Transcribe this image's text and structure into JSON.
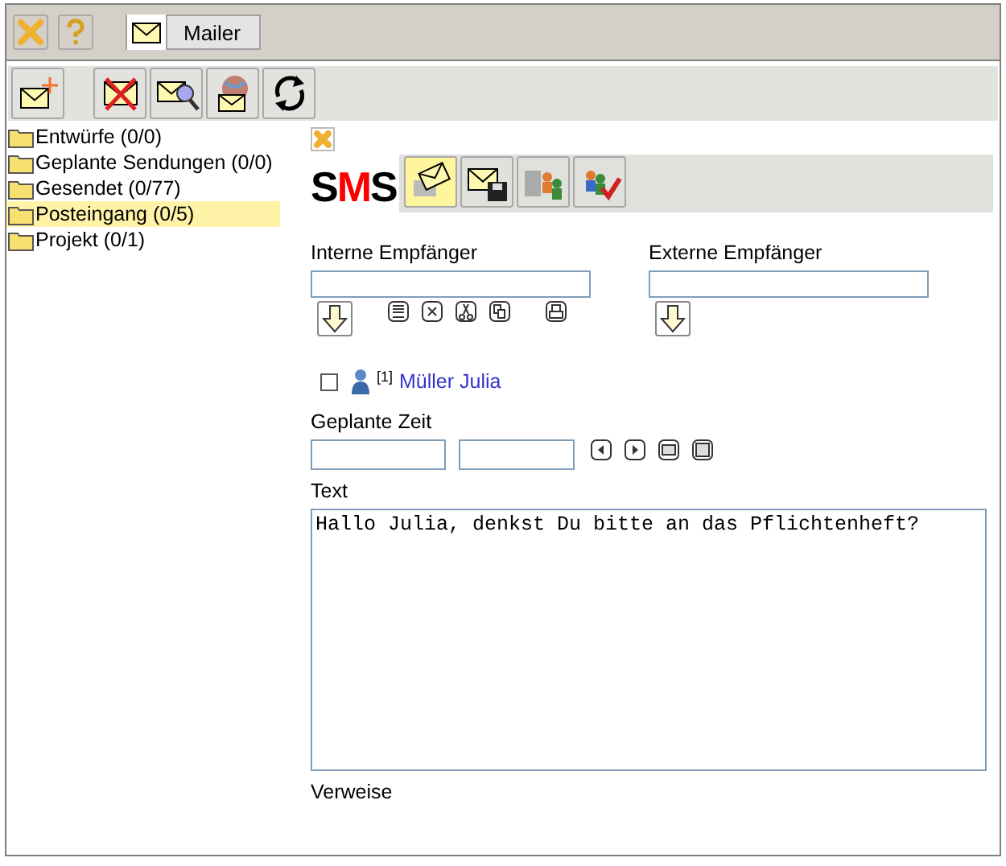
{
  "header": {
    "tab": "Mailer"
  },
  "folders": [
    {
      "label": "Entwürfe (0/0)",
      "selected": false
    },
    {
      "label": "Geplante Sendungen (0/0)",
      "selected": false
    },
    {
      "label": "Gesendet (0/77)",
      "selected": false
    },
    {
      "label": "Posteingang (0/5)",
      "selected": true
    },
    {
      "label": "Projekt (0/1)",
      "selected": false
    }
  ],
  "compose": {
    "logo": [
      {
        "text": "S",
        "color": "#000000"
      },
      {
        "text": "M",
        "color": "#ff0000"
      },
      {
        "text": "S",
        "color": "#000000"
      }
    ],
    "tools": [
      {
        "kind": "send",
        "selected": true
      },
      {
        "kind": "save",
        "selected": false
      },
      {
        "kind": "addressbook",
        "selected": false
      },
      {
        "kind": "checkusers",
        "selected": false
      }
    ],
    "internal_recipients": {
      "label": "Interne Empfänger"
    },
    "external_recipients": {
      "label": "Externe Empfänger"
    },
    "recipients": [
      {
        "checked": false,
        "index": "[1]",
        "name": "Müller Julia"
      }
    ],
    "scheduled_time": {
      "label": "Geplante Zeit"
    },
    "text": {
      "label": "Text",
      "value": "Hallo Julia, denkst Du bitte an das Pflichtenheft?"
    },
    "references": {
      "label": "Verweise"
    }
  }
}
